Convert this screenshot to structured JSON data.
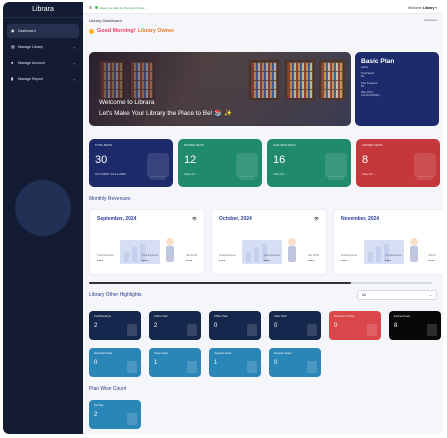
{
  "app": {
    "brand": "Librara"
  },
  "sidebar": {
    "items": [
      {
        "label": "Dashboard",
        "icon": "gauge-icon",
        "active": true,
        "chevron": false
      },
      {
        "label": "Manage Library",
        "icon": "book-icon",
        "active": false,
        "chevron": true
      },
      {
        "label": "Manage Account",
        "icon": "user-icon",
        "active": false,
        "chevron": true
      },
      {
        "label": "Manage Report",
        "icon": "chart-icon",
        "active": false,
        "chevron": true
      }
    ]
  },
  "topbar": {
    "menu_icon": "≡",
    "notice": "Enjoy your plan for the next 15 days",
    "welcome_prefix": "Welcome ",
    "welcome_user": "Library",
    "welcome_caret": "▾"
  },
  "header": {
    "title": "Library Dashboard",
    "breadcrumb": "Dashboard"
  },
  "greeting": {
    "good": "Good Morning!",
    "owner": "Library Owner"
  },
  "banner": {
    "line1": "Welcome to Librara",
    "line2": "Let's Make Your Library the Place to Be! 📚 ✨"
  },
  "plan": {
    "title": "Basic Plan",
    "status": "Active",
    "rows": [
      "Total Seats :",
      "50",
      "Plan Features :",
      "50",
      "Plan Price :",
      "120.00 Rs/Mthly"
    ]
  },
  "seats": [
    {
      "label": "TOTAL SEATS",
      "value": "30",
      "sub": "AS TODAY 04-11-2024",
      "color": "#1c2a6a"
    },
    {
      "label": "BOOKED SEATS",
      "value": "12",
      "sub": "View All →",
      "color": "#1f8a6c"
    },
    {
      "label": "AVAILABLE SEATS",
      "value": "16",
      "sub": "View All →",
      "color": "#1f8a6c"
    },
    {
      "label": "EXPIRED SEATS",
      "value": "8",
      "sub": "View All →",
      "color": "#c5373a"
    }
  ],
  "revenues": {
    "title": "Monthly Revenues",
    "cards": [
      {
        "month": "September, 2024",
        "stats": [
          {
            "label": "Total Revenue",
            "value": "****"
          },
          {
            "label": "Total Expense",
            "value": "****"
          },
          {
            "label": "Net Profit",
            "value": "****"
          }
        ]
      },
      {
        "month": "October, 2024",
        "stats": [
          {
            "label": "Total Revenue",
            "value": "****"
          },
          {
            "label": "Total Expense",
            "value": "****"
          },
          {
            "label": "Net Profit",
            "value": "****"
          }
        ]
      },
      {
        "month": "November, 2024",
        "stats": [
          {
            "label": "Total Revenue",
            "value": "****"
          },
          {
            "label": "Total Expense",
            "value": "****"
          },
          {
            "label": "Net Pr",
            "value": "****"
          }
        ]
      }
    ],
    "eye_icon": "👁"
  },
  "highlights": {
    "title": "Library Other Highlights",
    "filter": "All",
    "tiles": [
      {
        "label": "Total Bookings",
        "value": "2",
        "color": "#16274d"
      },
      {
        "label": "Online Paid",
        "value": "2",
        "color": "#16274d"
      },
      {
        "label": "Offline Paid",
        "value": "0",
        "color": "#16274d"
      },
      {
        "label": "Other Paid",
        "value": "0",
        "color": "#16274d"
      },
      {
        "label": "Expired in 5 Days",
        "value": "0",
        "color": "#d9474b"
      },
      {
        "label": "Expired Seats",
        "value": "8",
        "color": "#080808"
      },
      {
        "label": "Extended Seats",
        "value": "0",
        "color": "#2b86b8"
      },
      {
        "label": "Swap Seats",
        "value": "1",
        "color": "#2b86b8"
      },
      {
        "label": "Upgrade Seats",
        "value": "1",
        "color": "#2b86b8"
      },
      {
        "label": "Reactive Seats",
        "value": "0",
        "color": "#2b86b8"
      }
    ]
  },
  "plan_wise": {
    "title": "Plan Wise Count",
    "tiles": [
      {
        "label": "Full Day",
        "value": "2",
        "color": "#2b86b8"
      }
    ]
  }
}
